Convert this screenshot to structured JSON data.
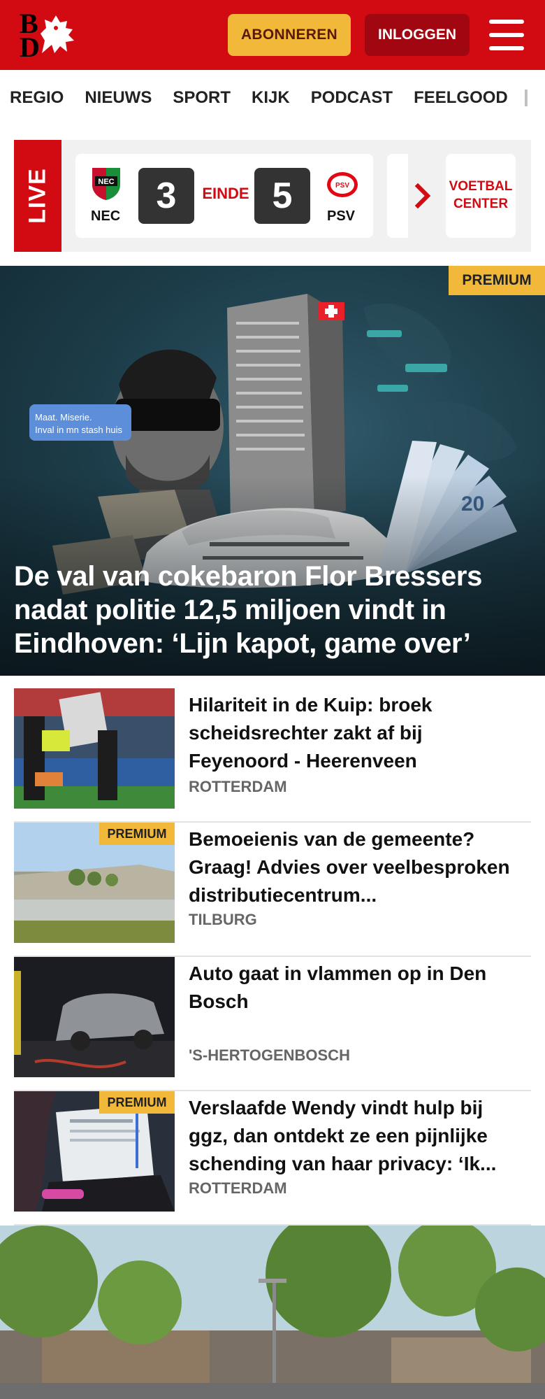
{
  "header": {
    "logo_b": "B",
    "logo_d": "D",
    "subscribe_label": "ABONNEREN",
    "login_label": "INLOGGEN",
    "brand_color": "#d20a11"
  },
  "nav": {
    "items": [
      {
        "label": "REGIO"
      },
      {
        "label": "NIEUWS"
      },
      {
        "label": "SPORT"
      },
      {
        "label": "KIJK"
      },
      {
        "label": "PODCAST"
      },
      {
        "label": "FEELGOOD"
      }
    ]
  },
  "live": {
    "tag": "LIVE",
    "match": {
      "home_team": "NEC",
      "away_team": "PSV",
      "home_score": "3",
      "away_score": "5",
      "status": "EINDE"
    },
    "center_line1": "VOETBAL",
    "center_line2": "CENTER"
  },
  "hero": {
    "premium": "PREMIUM",
    "bubble_line1": "Maat. Miserie.",
    "bubble_line2": "Inval in mn stash huis",
    "title": "De val van cokebaron Flor Bressers nadat politie 12,5 miljoen vindt in Eindhoven: ‘Lijn kapot, game over’"
  },
  "articles": [
    {
      "title": "Hilariteit in de Kuip: broek scheidsrechter zakt af bij Feyenoord - Heerenveen",
      "location": "ROTTERDAM",
      "premium": ""
    },
    {
      "title": "Bemoeienis van de gemeente? Graag! Advies over veelbespro­ken distributiecentrum...",
      "location": "TILBURG",
      "premium": "PREMIUM"
    },
    {
      "title": "Auto gaat in vlammen op in Den Bosch",
      "location": "'S-HERTOGENBOSCH",
      "premium": ""
    },
    {
      "title": "Verslaafde Wendy vindt hulp bij ggz, dan ontdekt ze een pijnlijke schending van haar privacy: ‘Ik...",
      "location": "ROTTERDAM",
      "premium": "PREMIUM"
    }
  ]
}
